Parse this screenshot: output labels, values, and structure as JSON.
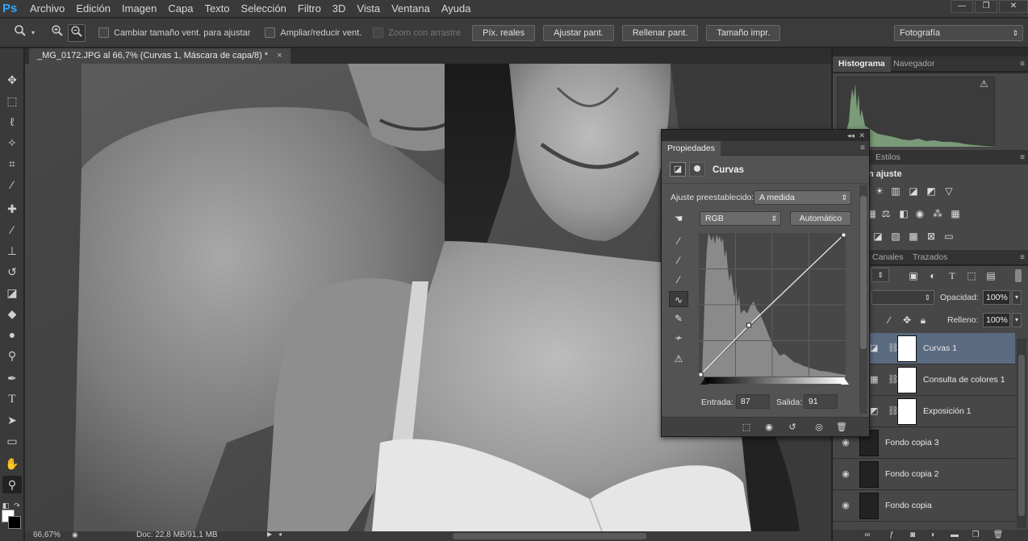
{
  "app": {
    "logo": "Ps",
    "menu": [
      "Archivo",
      "Edición",
      "Imagen",
      "Capa",
      "Texto",
      "Selección",
      "Filtro",
      "3D",
      "Vista",
      "Ventana",
      "Ayuda"
    ],
    "window_controls": [
      "—",
      "❐",
      "✕"
    ]
  },
  "options_bar": {
    "zoom_tool_icon": "magnifier-icon",
    "checkboxes": [
      {
        "label": "Cambiar tamaño vent. para ajustar",
        "checked": false,
        "enabled": true
      },
      {
        "label": "Ampliar/reducir vent.",
        "checked": false,
        "enabled": true
      },
      {
        "label": "Zoom con arrastre",
        "checked": false,
        "enabled": false
      }
    ],
    "buttons": [
      "Píx. reales",
      "Ajustar pant.",
      "Rellenar pant.",
      "Tamaño impr."
    ],
    "workspace": "Fotografía"
  },
  "document": {
    "tab_title": "_MG_0172.JPG al 66,7% (Curvas 1, Máscara de capa/8) *",
    "tab_close": "×"
  },
  "status": {
    "zoom": "66,67%",
    "doc_info": "Doc: 22,8 MB/91,1 MB"
  },
  "histogram_panel": {
    "tabs": [
      "Histograma",
      "Navegador"
    ],
    "warning": "⚠"
  },
  "adjustments_panel": {
    "tabs": [
      "Estilos"
    ],
    "title": "n ajuste"
  },
  "layers_panel": {
    "tabs": [
      "Canales",
      "Trazados"
    ],
    "opacity_label": "Opacidad:",
    "opacity_value": "100%",
    "fill_label": "Relleno:",
    "fill_value": "100%",
    "layers": [
      {
        "name": "Curvas 1",
        "type": "adjustment",
        "selected": true
      },
      {
        "name": "Consulta de colores 1",
        "type": "adjustment",
        "selected": false
      },
      {
        "name": "Exposición 1",
        "type": "adjustment",
        "selected": false
      },
      {
        "name": "Fondo copia 3",
        "type": "image",
        "selected": false
      },
      {
        "name": "Fondo copia 2",
        "type": "image",
        "selected": false
      },
      {
        "name": "Fondo copia",
        "type": "image",
        "selected": false
      }
    ]
  },
  "properties_panel": {
    "tab": "Propiedades",
    "title": "Curvas",
    "preset_label": "Ajuste preestablecido:",
    "preset_value": "A medida",
    "channel_value": "RGB",
    "auto_button": "Automático",
    "input_label": "Entrada:",
    "input_value": "87",
    "output_label": "Salida:",
    "output_value": "91",
    "curve_point": {
      "input": 87,
      "output": 91
    }
  },
  "colors": {
    "selected_layer": "#5a6a80",
    "histogram_fill": "#7a9a78",
    "ps_blue": "#31a8ff"
  }
}
